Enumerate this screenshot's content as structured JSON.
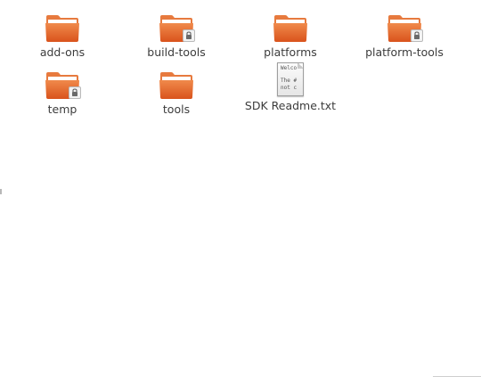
{
  "colors": {
    "folder_front_top": "#f08a4b",
    "folder_front_bottom": "#d9531c",
    "folder_back": "#e77a3e",
    "folder_tab": "#ef8b52",
    "paper": "#ffffff",
    "label_text": "#3c3c3c",
    "background": "#ffffff"
  },
  "items": [
    {
      "label": "add-ons",
      "kind": "folder",
      "icon": "folder-icon",
      "locked": false
    },
    {
      "label": "build-tools",
      "kind": "folder",
      "icon": "folder-icon",
      "locked": true
    },
    {
      "label": "platforms",
      "kind": "folder",
      "icon": "folder-icon",
      "locked": false
    },
    {
      "label": "platform-tools",
      "kind": "folder",
      "icon": "folder-icon",
      "locked": true
    },
    {
      "label": "temp",
      "kind": "folder",
      "icon": "folder-icon",
      "locked": true
    },
    {
      "label": "tools",
      "kind": "folder",
      "icon": "folder-icon",
      "locked": false
    },
    {
      "label": "SDK Readme.txt",
      "kind": "text-file",
      "icon": "text-file-icon",
      "locked": false,
      "preview": [
        "Welco",
        "The #",
        "not c"
      ]
    }
  ]
}
